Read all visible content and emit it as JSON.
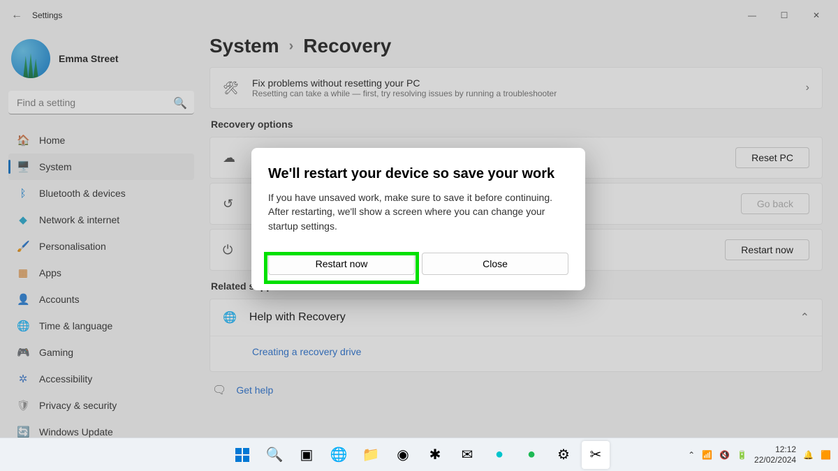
{
  "window": {
    "title": "Settings"
  },
  "user": {
    "name": "Emma Street",
    "email": ""
  },
  "search": {
    "placeholder": "Find a setting"
  },
  "nav": [
    {
      "icon": "🏠",
      "label": "Home"
    },
    {
      "icon": "🖥️",
      "label": "System",
      "active": true
    },
    {
      "icon": "ᛒ",
      "label": "Bluetooth & devices",
      "iconColor": "#0078d4"
    },
    {
      "icon": "◆",
      "label": "Network & internet",
      "iconColor": "#1aa3c9"
    },
    {
      "icon": "🖌️",
      "label": "Personalisation"
    },
    {
      "icon": "▦",
      "label": "Apps",
      "iconColor": "#d97b1a"
    },
    {
      "icon": "👤",
      "label": "Accounts",
      "iconColor": "#e8a33d"
    },
    {
      "icon": "🌐",
      "label": "Time & language"
    },
    {
      "icon": "🎮",
      "label": "Gaming",
      "iconColor": "#777"
    },
    {
      "icon": "✲",
      "label": "Accessibility",
      "iconColor": "#3a77c9"
    },
    {
      "icon": "🛡",
      "label": "Privacy & security",
      "iconColor": "#888"
    },
    {
      "icon": "🔄",
      "label": "Windows Update",
      "iconColor": "#1a8fd4"
    }
  ],
  "breadcrumb": {
    "parent": "System",
    "current": "Recovery"
  },
  "fix_card": {
    "title": "Fix problems without resetting your PC",
    "subtitle": "Resetting can take a while — first, try resolving issues by running a troubleshooter"
  },
  "section_recovery": "Recovery options",
  "cards": {
    "reset": {
      "button": "Reset PC"
    },
    "goback": {
      "button": "Go back",
      "disabled": true
    },
    "restart": {
      "button": "Restart now"
    }
  },
  "section_related": "Related support",
  "support": {
    "title": "Help with Recovery",
    "link": "Creating a recovery drive"
  },
  "gethelp": "Get help",
  "dialog": {
    "title": "We'll restart your device so save your work",
    "body": "If you have unsaved work, make sure to save it before continuing. After restarting, we'll show a screen where you can change your startup settings.",
    "primary": "Restart now",
    "secondary": "Close"
  },
  "taskbar": {
    "time": "12:12",
    "date": "22/02/2024"
  }
}
